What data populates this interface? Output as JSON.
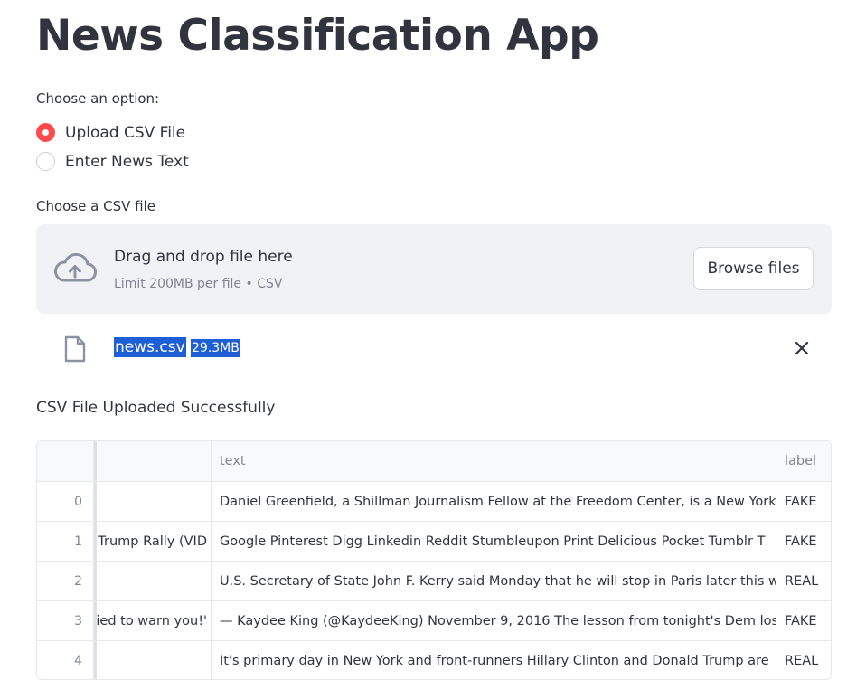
{
  "app": {
    "title": "News Classification App"
  },
  "option": {
    "label": "Choose an option:",
    "choices": [
      {
        "label": "Upload CSV File",
        "selected": true
      },
      {
        "label": "Enter News Text",
        "selected": false
      }
    ]
  },
  "uploader": {
    "label": "Choose a CSV file",
    "drop_title": "Drag and drop file here",
    "drop_subtitle": "Limit 200MB per file • CSV",
    "browse_label": "Browse files",
    "icon": "cloud-upload-icon"
  },
  "file": {
    "name": "news.csv",
    "size": "29.3MB",
    "icon": "file-icon"
  },
  "status": "CSV File Uploaded Successfully",
  "table": {
    "columns": [
      "",
      "",
      "text",
      "label"
    ],
    "rows": [
      {
        "index": "0",
        "title": "",
        "text": "Daniel Greenfield, a Shillman Journalism Fellow at the Freedom Center, is a New York",
        "label": "FAKE"
      },
      {
        "index": "1",
        "title": "A Trump Rally (VID",
        "text": "Google Pinterest Digg Linkedin Reddit Stumbleupon Print Delicious Pocket Tumblr  T",
        "label": "FAKE"
      },
      {
        "index": "2",
        "title": "",
        "text": "U.S. Secretary of State John F. Kerry said Monday that he will stop in Paris later this w",
        "label": "REAL"
      },
      {
        "index": "3",
        "title": "ied to warn you!'",
        "text": "— Kaydee King (@KaydeeKing) November 9, 2016 The lesson from tonight's Dem loss",
        "label": "FAKE"
      },
      {
        "index": "4",
        "title": "",
        "text": "It's primary day in New York and front-runners Hillary Clinton and Donald Trump are",
        "label": "REAL"
      }
    ]
  },
  "colors": {
    "accent": "#ff4b4b",
    "selection": "#1e5fd6",
    "dropzone_bg": "#f0f2f6",
    "text": "#31333f",
    "muted": "#808495"
  }
}
